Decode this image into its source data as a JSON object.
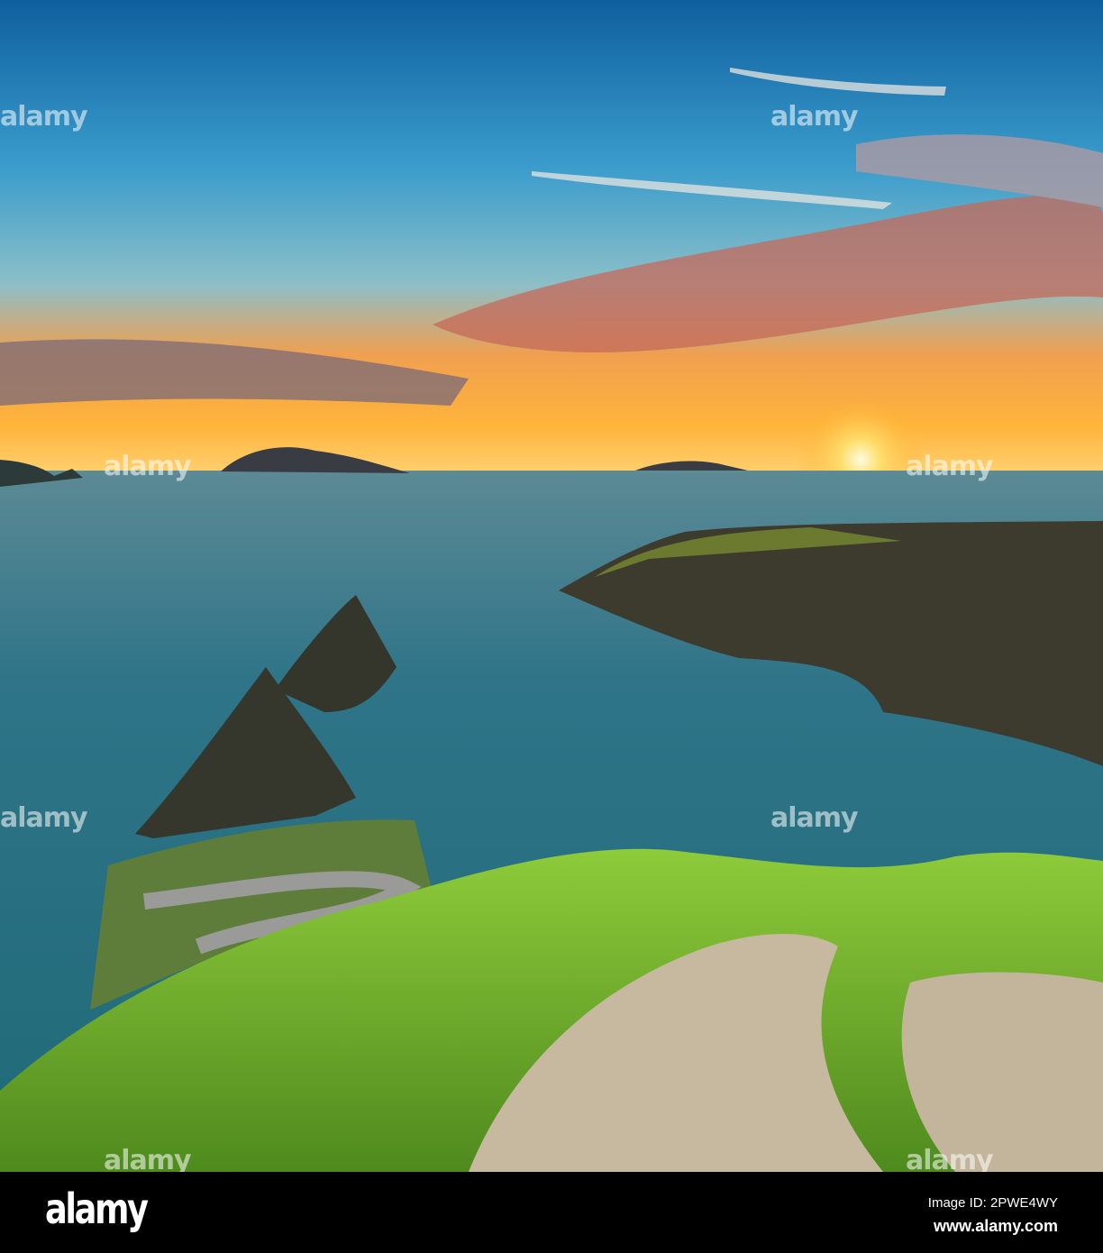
{
  "watermark": {
    "text": "alamy"
  },
  "footer": {
    "logo": "alamy",
    "image_id": "Image ID: 2PWE4WY",
    "url": "www.alamy.com"
  }
}
